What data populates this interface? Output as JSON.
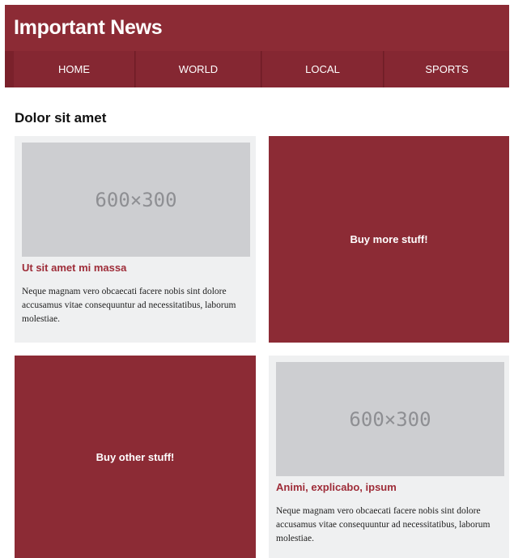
{
  "header": {
    "title": "Important News"
  },
  "nav": {
    "items": [
      {
        "label": "HOME"
      },
      {
        "label": "WORLD"
      },
      {
        "label": "LOCAL"
      },
      {
        "label": "SPORTS"
      }
    ]
  },
  "main": {
    "section_title": "Dolor sit amet",
    "articles": [
      {
        "image_label": "600×300",
        "title": "Ut sit amet mi massa",
        "body": "Neque magnam vero obcaecati facere nobis sint dolore accusamus vitae consequuntur ad necessitatibus, laborum molestiae."
      },
      {
        "image_label": "600×300",
        "title": "Animi, explicabo, ipsum",
        "body": "Neque magnam vero obcaecati facere nobis sint dolore accusamus vitae consequuntur ad necessitatibus, laborum molestiae."
      }
    ],
    "ads": [
      {
        "label": "Buy more stuff!"
      },
      {
        "label": "Buy other stuff!"
      }
    ]
  },
  "colors": {
    "brand": "#8c2b35",
    "nav": "#7a212b",
    "card_bg": "#eff0f1",
    "placeholder": "#cdced1",
    "title_red": "#9e2c38"
  }
}
